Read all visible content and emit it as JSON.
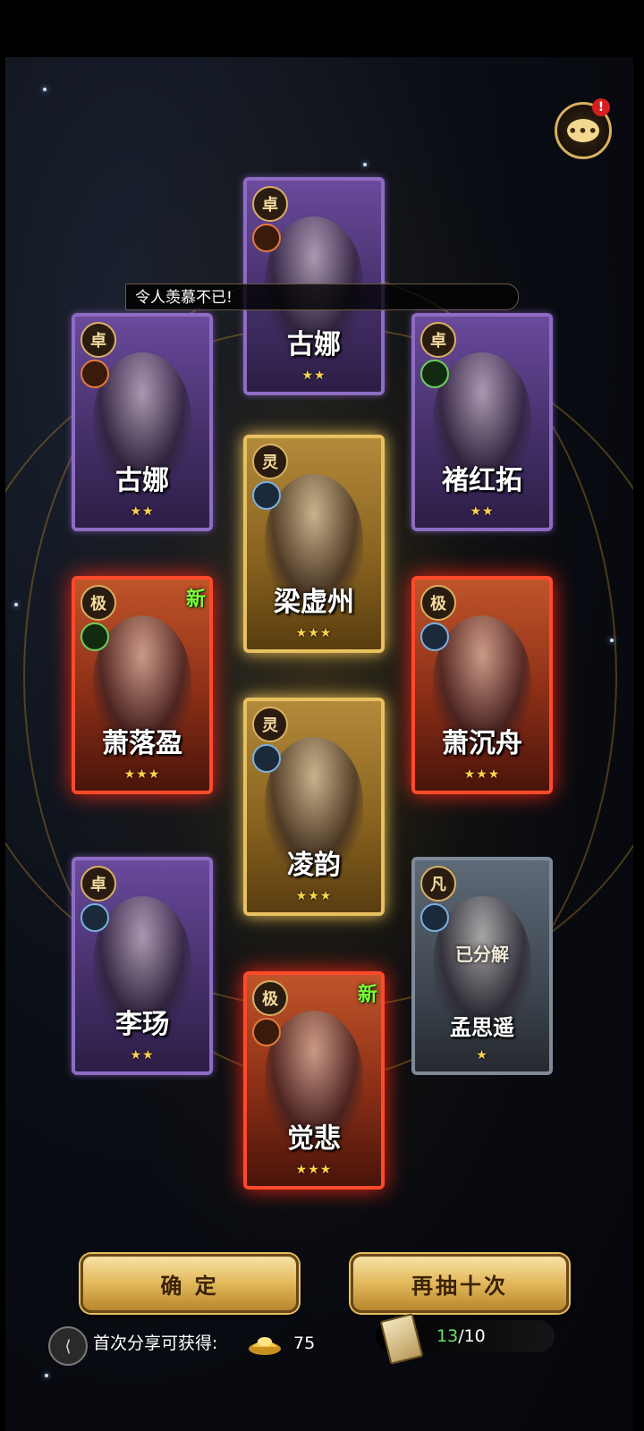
{
  "chat": {
    "badge": "!",
    "icon": "chat-bubble-icon",
    "dots": "•••"
  },
  "broadcast": {
    "text": "令人羡慕不已!"
  },
  "cards": [
    {
      "rank": "卓",
      "name": "古娜",
      "stars": 2,
      "rarity": "purple",
      "element": "fire"
    },
    {
      "rank": "卓",
      "name": "古娜",
      "stars": 2,
      "rarity": "purple",
      "element": "fire"
    },
    {
      "rank": "卓",
      "name": "褚红拓",
      "stars": 2,
      "rarity": "purple",
      "element": "green"
    },
    {
      "rank": "灵",
      "name": "梁虚州",
      "stars": 3,
      "rarity": "gold",
      "element": "water"
    },
    {
      "rank": "极",
      "name": "萧落盈",
      "stars": 3,
      "rarity": "red",
      "element": "green",
      "new": "新"
    },
    {
      "rank": "极",
      "name": "萧沉舟",
      "stars": 3,
      "rarity": "red",
      "element": "water"
    },
    {
      "rank": "灵",
      "name": "凌韵",
      "stars": 3,
      "rarity": "gold",
      "element": "water"
    },
    {
      "rank": "卓",
      "name": "李玚",
      "stars": 2,
      "rarity": "purple",
      "element": "water"
    },
    {
      "rank": "凡",
      "name": "孟思遥",
      "stars": 1,
      "rarity": "gray",
      "element": "water",
      "status": "已分解"
    },
    {
      "rank": "极",
      "name": "觉悲",
      "stars": 3,
      "rarity": "red",
      "element": "fire",
      "new": "新"
    }
  ],
  "buttons": {
    "confirm": "确 定",
    "draw_ten": "再抽十次"
  },
  "share": {
    "text": "首次分享可获得:",
    "reward": "75",
    "icon": "share-icon",
    "currency_icon": "gold-ingot-icon"
  },
  "tickets": {
    "current": "13",
    "total": "/10",
    "icon": "ticket-icon"
  }
}
